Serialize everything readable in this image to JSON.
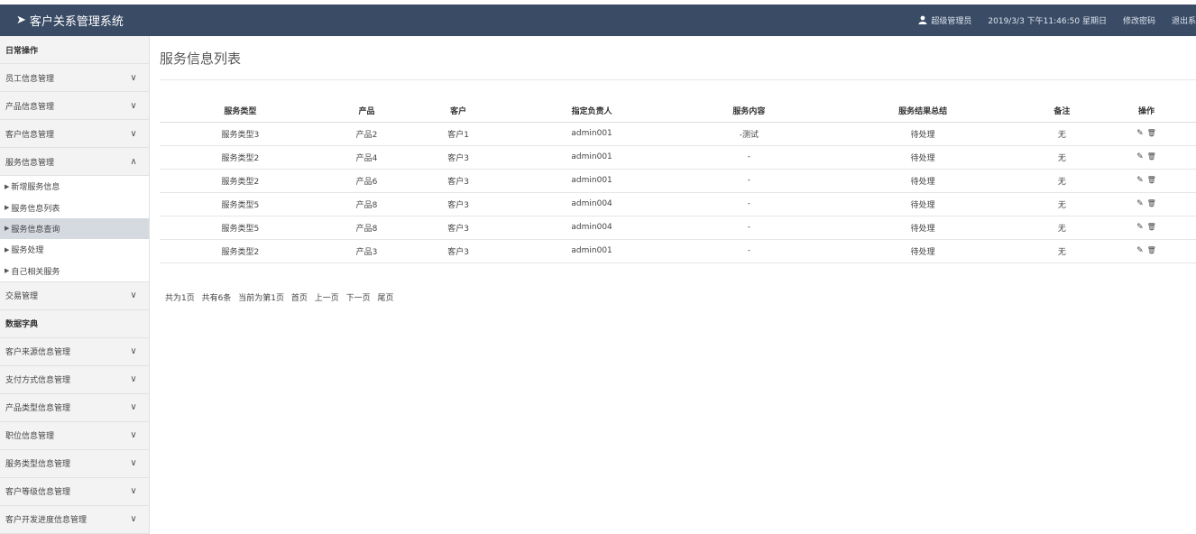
{
  "header": {
    "app_title": "客户关系管理系统",
    "user": "超级管理员",
    "datetime": "2019/3/3 下午11:46:50 星期日",
    "change_password": "修改密码",
    "logout": "退出系"
  },
  "sidebar": {
    "section_daily": "日常操作",
    "items": [
      {
        "label": "员工信息管理",
        "chevron": "∨"
      },
      {
        "label": "产品信息管理",
        "chevron": "∨"
      },
      {
        "label": "客户信息管理",
        "chevron": "∨"
      },
      {
        "label": "服务信息管理",
        "chevron": "∧"
      }
    ],
    "subitems": [
      "新增服务信息",
      "服务信息列表",
      "服务信息查询",
      "服务处理",
      "自己相关服务"
    ],
    "trade": {
      "label": "交易管理",
      "chevron": "∨"
    },
    "section_dict": "数据字典",
    "dict_items": [
      {
        "label": "客户来源信息管理",
        "chevron": "∨"
      },
      {
        "label": "支付方式信息管理",
        "chevron": "∨"
      },
      {
        "label": "产品类型信息管理",
        "chevron": "∨"
      },
      {
        "label": "职位信息管理",
        "chevron": "∨"
      },
      {
        "label": "服务类型信息管理",
        "chevron": "∨"
      },
      {
        "label": "客户等级信息管理",
        "chevron": "∨"
      },
      {
        "label": "客户开发进度信息管理",
        "chevron": "∨"
      }
    ]
  },
  "main": {
    "title": "服务信息列表",
    "columns": [
      "服务类型",
      "产品",
      "客户",
      "指定负责人",
      "服务内容",
      "服务结果总结",
      "备注",
      "操作"
    ],
    "rows": [
      [
        "服务类型3",
        "产品2",
        "客户1",
        "admin001",
        "-测试",
        "待处理",
        "无"
      ],
      [
        "服务类型2",
        "产品4",
        "客户3",
        "admin001",
        "-",
        "待处理",
        "无"
      ],
      [
        "服务类型2",
        "产品6",
        "客户3",
        "admin001",
        "-",
        "待处理",
        "无"
      ],
      [
        "服务类型5",
        "产品8",
        "客户3",
        "admin004",
        "-",
        "待处理",
        "无"
      ],
      [
        "服务类型5",
        "产品8",
        "客户3",
        "admin004",
        "-",
        "待处理",
        "无"
      ],
      [
        "服务类型2",
        "产品3",
        "客户3",
        "admin001",
        "-",
        "待处理",
        "无"
      ]
    ],
    "ops": {
      "edit": "✎",
      "delete": "🗑"
    },
    "pager": {
      "total_pages": "共为1页",
      "total_records": "共有6条",
      "current": "当前为第1页",
      "first": "首页",
      "prev": "上一页",
      "next": "下一页",
      "last": "尾页"
    }
  }
}
